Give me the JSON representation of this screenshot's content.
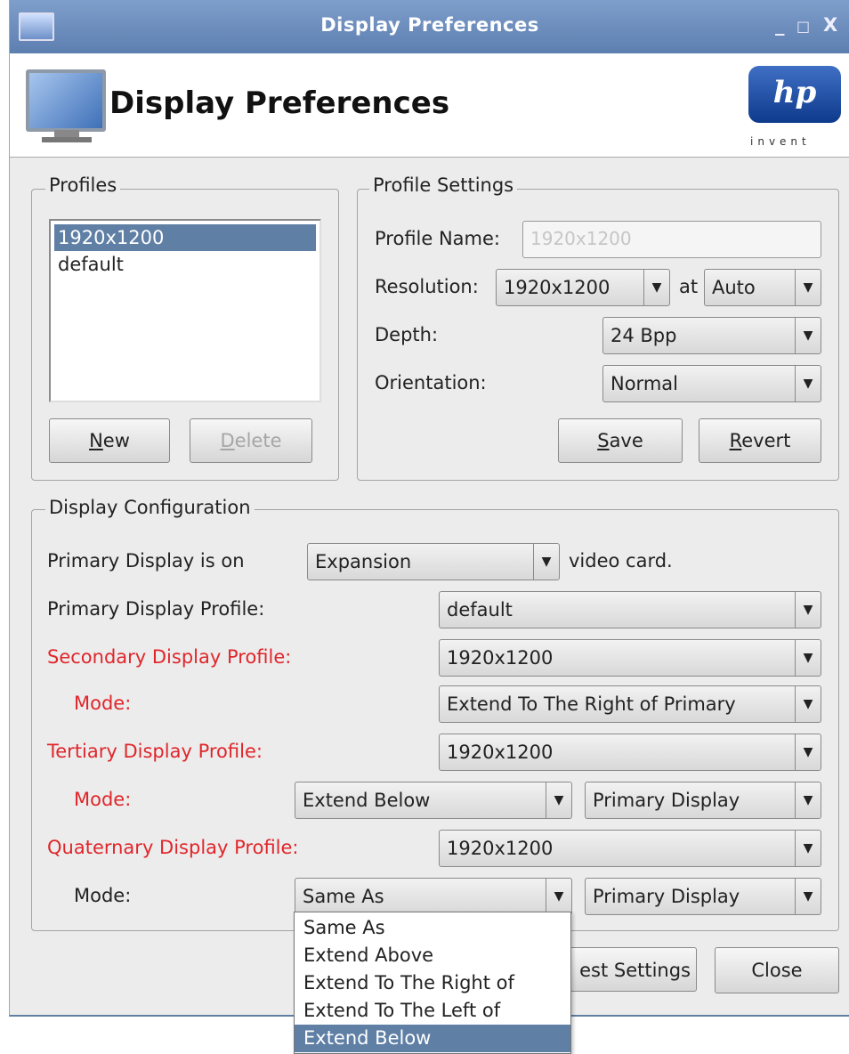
{
  "window": {
    "title": "Display Preferences",
    "minimize": "_",
    "maximize": "□",
    "close": "X"
  },
  "header": {
    "title": "Display Preferences",
    "logo_text": "hp",
    "logo_tagline": "invent"
  },
  "profiles": {
    "legend": "Profiles",
    "items": [
      "1920x1200",
      "default"
    ],
    "new_button": {
      "pre": "",
      "u": "N",
      "post": "ew"
    },
    "delete_button": {
      "pre": "",
      "u": "D",
      "post": "elete"
    }
  },
  "profile_settings": {
    "legend": "Profile Settings",
    "name_label": "Profile Name:",
    "name_value": "1920x1200",
    "resolution_label": "Resolution:",
    "resolution_value": "1920x1200",
    "at_label": "at",
    "refresh_value": "Auto",
    "depth_label": "Depth:",
    "depth_value": "24 Bpp",
    "orientation_label": "Orientation:",
    "orientation_value": "Normal",
    "save_button": {
      "pre": "",
      "u": "S",
      "post": "ave"
    },
    "revert_button": {
      "pre": "",
      "u": "R",
      "post": "evert"
    }
  },
  "display_config": {
    "legend": "Display Configuration",
    "primary_on_label": "Primary Display is on",
    "primary_on_value": "Expansion",
    "video_card_label": "video card.",
    "primary_profile_label": "Primary Display Profile:",
    "primary_profile_value": "default",
    "secondary_profile_label": "Secondary Display Profile:",
    "secondary_profile_value": "1920x1200",
    "secondary_mode_label": "Mode:",
    "secondary_mode_value": "Extend To The Right of Primary",
    "tertiary_profile_label": "Tertiary Display Profile:",
    "tertiary_profile_value": "1920x1200",
    "tertiary_mode_label": "Mode:",
    "tertiary_mode_value": "Extend Below",
    "tertiary_relative_value": "Primary Display",
    "quaternary_profile_label": "Quaternary Display Profile:",
    "quaternary_profile_value": "1920x1200",
    "quaternary_mode_label": "Mode:",
    "quaternary_mode_value": "Same As",
    "quaternary_relative_value": "Primary Display"
  },
  "footer": {
    "test_settings_label": "est Settings",
    "close_label": "Close"
  },
  "dropdown": {
    "options": [
      "Same As",
      "Extend Above",
      "Extend To The Right of",
      "Extend To The Left of",
      "Extend Below"
    ],
    "highlighted": "Extend Below"
  },
  "colors": {
    "titlebar": "#6a8bbd",
    "selection": "#5f7fa5",
    "warning_label": "#e0262b",
    "hp_blue": "#1f4fa3"
  }
}
